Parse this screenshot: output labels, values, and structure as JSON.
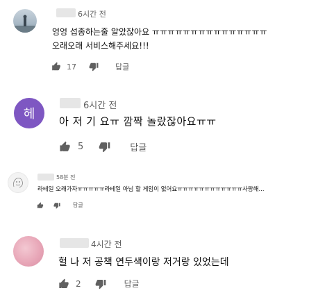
{
  "comments": [
    {
      "time": "6시간 전",
      "lines": [
        "엉엉 섭종하는줄 알았잖아요 ㅠㅠㅠㅠㅠㅠㅠㅠㅠㅠㅠㅠㅠㅠㅠ",
        "오래오래 서비스해주세요!!!"
      ],
      "likes": "17",
      "reply": "답글"
    },
    {
      "avatar_letter": "헤",
      "time": "6시간 전",
      "lines": [
        "아 저 기 요ㅠ 깜짝 놀랐잖아요ㅠㅠ"
      ],
      "likes": "5",
      "reply": "답글"
    },
    {
      "time": "58분 전",
      "lines": [
        "라테일 오래가자ㅠㅠㅠㅠㅠ라테일 아님 할 게임이 없어요ㅠㅠㅠㅠㅠㅠㅠㅠㅠㅠㅠㅠ사랑해..."
      ],
      "likes": "",
      "reply": "답글"
    },
    {
      "time": "4시간 전",
      "lines": [
        "헐 나 저 공책 연두색이랑 저거랑 있었는데"
      ],
      "likes": "2",
      "reply": "답글"
    }
  ],
  "colors": {
    "text": "#0f0f0f",
    "meta": "#606060",
    "avatar_purple": "#7e57c2"
  }
}
